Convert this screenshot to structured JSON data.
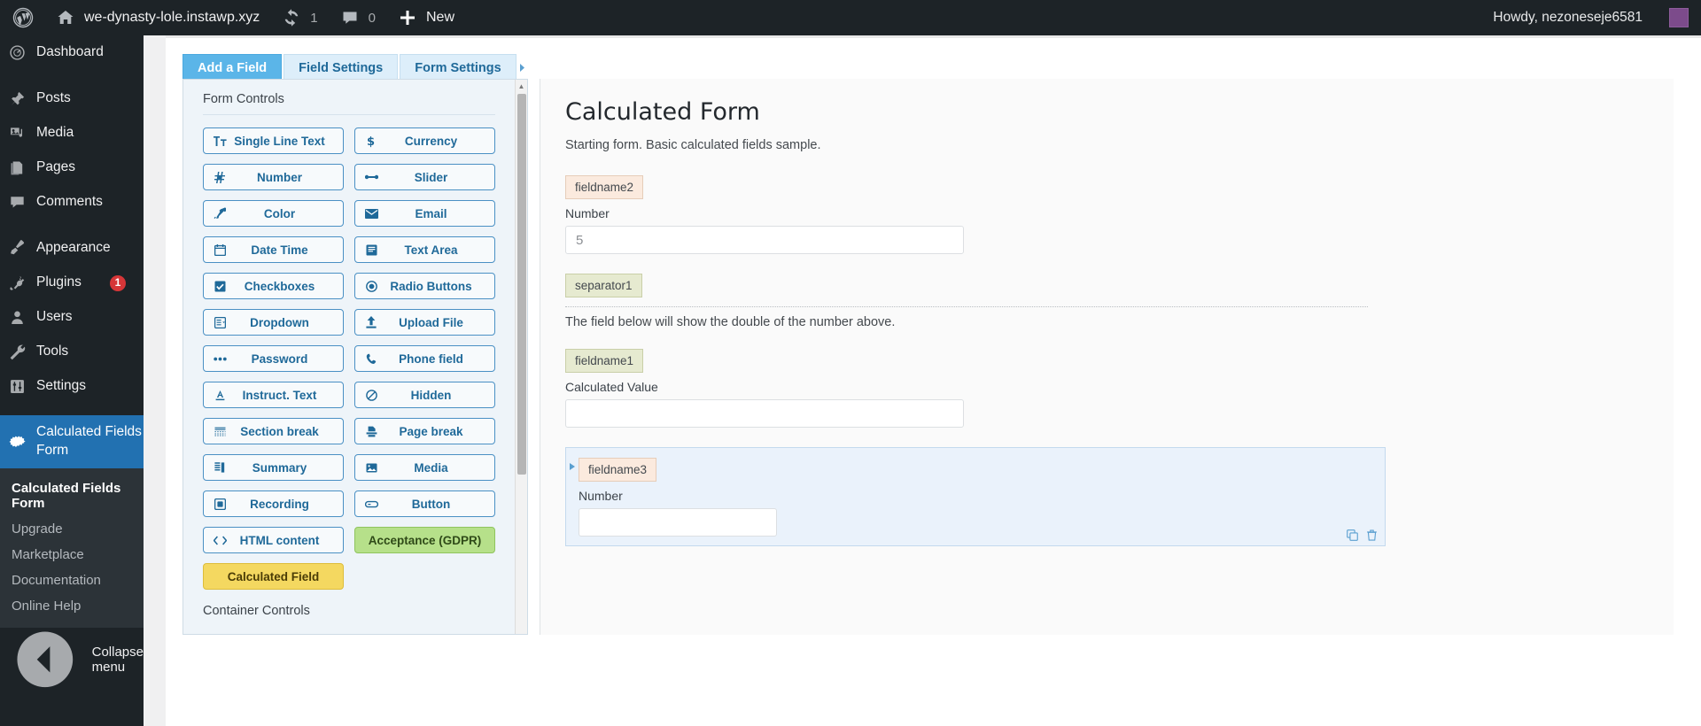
{
  "adminbar": {
    "logo_icon": "wordpress-logo-icon",
    "home_icon": "home-icon",
    "site_name": "we-dynasty-lole.instawp.xyz",
    "updates_icon": "updates-icon",
    "updates_count": "1",
    "comments_icon": "comment-bubble-icon",
    "comments_count": "0",
    "new_icon": "plus-icon",
    "new_label": "New",
    "howdy": "Howdy, nezoneseje6581",
    "avatar_icon": "avatar"
  },
  "sidebar": {
    "items": [
      {
        "label": "Dashboard",
        "icon": "dashboard-icon",
        "current": false
      },
      {
        "label": "Posts",
        "icon": "pin-icon",
        "current": false
      },
      {
        "label": "Media",
        "icon": "media-icon",
        "current": false
      },
      {
        "label": "Pages",
        "icon": "pages-icon",
        "current": false
      },
      {
        "label": "Comments",
        "icon": "comment-bubble-icon",
        "current": false
      },
      {
        "label": "Appearance",
        "icon": "paintbrush-icon",
        "current": false
      },
      {
        "label": "Plugins",
        "icon": "plug-icon",
        "current": false,
        "badge": "1"
      },
      {
        "label": "Users",
        "icon": "user-icon",
        "current": false
      },
      {
        "label": "Tools",
        "icon": "wrench-icon",
        "current": false
      },
      {
        "label": "Settings",
        "icon": "sliders-icon",
        "current": false
      },
      {
        "label": "Calculated Fields Form",
        "icon": "gear-icon",
        "current": true
      }
    ],
    "submenu": [
      {
        "label": "Calculated Fields Form",
        "current": true
      },
      {
        "label": "Upgrade",
        "current": false
      },
      {
        "label": "Marketplace",
        "current": false
      },
      {
        "label": "Documentation",
        "current": false
      },
      {
        "label": "Online Help",
        "current": false
      }
    ],
    "collapse_label": "Collapse menu",
    "collapse_icon": "collapse-arrow-icon"
  },
  "tabs": [
    {
      "label": "Add a Field",
      "active": true
    },
    {
      "label": "Field Settings",
      "active": false
    },
    {
      "label": "Form Settings",
      "active": false
    }
  ],
  "tabs_more_icon": "chevron-right-icon",
  "builder": {
    "form_controls_title": "Form Controls",
    "container_controls_title": "Container Controls",
    "buttons": [
      {
        "label": "Single Line Text",
        "icon": "text-format-icon",
        "glyph": "Tт",
        "style": "default"
      },
      {
        "label": "Currency",
        "icon": "currency-dollar-icon",
        "glyph": "$",
        "style": "default"
      },
      {
        "label": "Number",
        "icon": "hash-number-icon",
        "glyph": "#",
        "style": "default"
      },
      {
        "label": "Slider",
        "icon": "slider-icon",
        "glyph": "•••",
        "style": "default"
      },
      {
        "label": "Color",
        "icon": "eyedropper-icon",
        "glyph": "✐",
        "style": "default"
      },
      {
        "label": "Email",
        "icon": "envelope-icon",
        "glyph": "✉",
        "style": "default"
      },
      {
        "label": "Date Time",
        "icon": "calendar-icon",
        "glyph": "□",
        "style": "default"
      },
      {
        "label": "Text Area",
        "icon": "text-area-icon",
        "glyph": "☰",
        "style": "default"
      },
      {
        "label": "Checkboxes",
        "icon": "checkbox-checked-icon",
        "glyph": "☑",
        "style": "default"
      },
      {
        "label": "Radio Buttons",
        "icon": "radio-button-icon",
        "glyph": "◉",
        "style": "default"
      },
      {
        "label": "Dropdown",
        "icon": "dropdown-list-icon",
        "glyph": "≣",
        "style": "default"
      },
      {
        "label": "Upload File",
        "icon": "upload-arrow-icon",
        "glyph": "↑",
        "style": "default"
      },
      {
        "label": "Password",
        "icon": "password-dots-icon",
        "glyph": "•••",
        "style": "default"
      },
      {
        "label": "Phone field",
        "icon": "phone-icon",
        "glyph": "☎",
        "style": "default"
      },
      {
        "label": "Instruct. Text",
        "icon": "text-underline-icon",
        "glyph": "A",
        "style": "default"
      },
      {
        "label": "Hidden",
        "icon": "no-entry-icon",
        "glyph": "⊘",
        "style": "default"
      },
      {
        "label": "Section break",
        "icon": "section-break-icon",
        "glyph": "≡",
        "style": "default"
      },
      {
        "label": "Page break",
        "icon": "page-break-icon",
        "glyph": "⤒",
        "style": "default"
      },
      {
        "label": "Summary",
        "icon": "summary-list-icon",
        "glyph": "▤",
        "style": "default"
      },
      {
        "label": "Media",
        "icon": "image-icon",
        "glyph": "⛰",
        "style": "default"
      },
      {
        "label": "Recording",
        "icon": "record-icon",
        "glyph": "▣",
        "style": "default"
      },
      {
        "label": "Button",
        "icon": "button-icon",
        "glyph": "▭",
        "style": "default"
      },
      {
        "label": "HTML content",
        "icon": "code-brackets-icon",
        "glyph": "<>",
        "style": "default"
      },
      {
        "label": "Acceptance (GDPR)",
        "icon": "gdpr-icon",
        "glyph": "",
        "style": "green"
      },
      {
        "label": "Calculated Field",
        "icon": "calculated-field-icon",
        "glyph": "",
        "style": "yellow"
      }
    ]
  },
  "preview": {
    "title": "Calculated Form",
    "description": "Starting form. Basic calculated fields sample.",
    "fields": [
      {
        "name_badge": "fieldname2",
        "badge_style": "peach",
        "label": "Number",
        "value": "5",
        "is_placeholder": true
      },
      {
        "name_badge": "separator1",
        "badge_style": "olive",
        "separator_text": "The field below will show the double of the number above."
      },
      {
        "name_badge": "fieldname1",
        "badge_style": "olive",
        "label": "Calculated Value",
        "value": "",
        "is_placeholder": false
      },
      {
        "name_badge": "fieldname3",
        "badge_style": "peach",
        "label": "Number",
        "value": "",
        "selected": true,
        "duplicate_icon": "duplicate-icon",
        "delete_icon": "trash-icon"
      }
    ]
  }
}
